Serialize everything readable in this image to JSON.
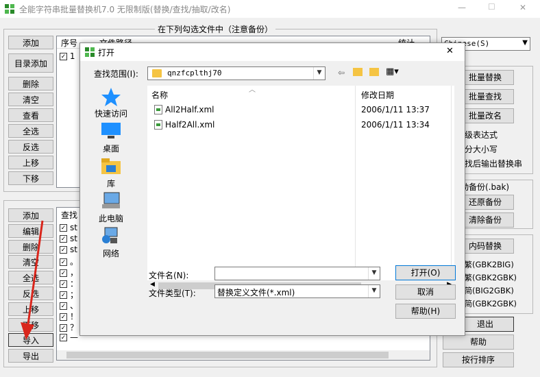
{
  "app": {
    "title": "全能字符串批量替换机7.0 无限制版(替换/查找/抽取/改名)",
    "window_controls": {
      "minimize": "—",
      "maximize": "☐",
      "close": "✕"
    }
  },
  "top_group": {
    "title": "在下列勾选文件中（注意备份）",
    "buttons": [
      "添加",
      "目录添加",
      "删除",
      "清空",
      "查看",
      "全选",
      "反选",
      "上移",
      "下移"
    ],
    "columns": [
      "序号",
      "文件路径",
      "统计"
    ],
    "rows": [
      {
        "index": "1",
        "checked": true
      }
    ]
  },
  "bottom_group": {
    "buttons": [
      "添加",
      "编辑",
      "删除",
      "清空",
      "全选",
      "反选",
      "上移",
      "下移",
      "导入",
      "导出"
    ],
    "columns": [
      "查找"
    ],
    "rows": [
      {
        "text": "st",
        "checked": true
      },
      {
        "text": "st",
        "checked": true
      },
      {
        "text": "st",
        "checked": true
      },
      {
        "text": "。",
        "checked": true
      },
      {
        "text": "，",
        "checked": true
      },
      {
        "text": "：",
        "checked": true
      },
      {
        "text": "；",
        "checked": true
      },
      {
        "text": "、",
        "checked": true
      },
      {
        "text": "！",
        "checked": true
      },
      {
        "text": "？",
        "checked": true
      },
      {
        "text": "—",
        "checked": true
      }
    ]
  },
  "right_panel": {
    "language": "Chinese(S)",
    "actions": [
      "批量替换",
      "批量查找",
      "批量改名"
    ],
    "options": [
      "高级表达式",
      "区分大小写",
      "查找后输出替换串"
    ],
    "backup": {
      "auto": "自动备份(.bak)",
      "restore": "还原备份",
      "clear": "清除备份"
    },
    "inner_replace": "内码替换",
    "conversions": [
      "转繁(GBK2BIG)",
      "转繁(GBK2GBK)",
      "转简(BIG2GBK)",
      "转简(GBK2GBK)"
    ],
    "exit": "退出",
    "help": "帮助",
    "sort": "按行排序"
  },
  "dialog": {
    "title": "打开",
    "look_in_label": "查找范围(I):",
    "look_in_value": "qnzfcplthj70",
    "places": [
      "快速访问",
      "桌面",
      "库",
      "此电脑",
      "网络"
    ],
    "columns": {
      "name": "名称",
      "date": "修改日期"
    },
    "files": [
      {
        "name": "All2Half.xml",
        "date": "2006/1/11 13:37"
      },
      {
        "name": "Half2All.xml",
        "date": "2006/1/11 13:34"
      }
    ],
    "filename_label": "文件名(N):",
    "filename_value": "",
    "filetype_label": "文件类型(T):",
    "filetype_value": "替换定义文件(*.xml)",
    "open_button": "打开(O)",
    "cancel_button": "取消",
    "help_button": "帮助(H)"
  },
  "colors": {
    "arrow": "#d9261c",
    "folder": "#f5c443",
    "title_icon": "#2a8a2a"
  }
}
